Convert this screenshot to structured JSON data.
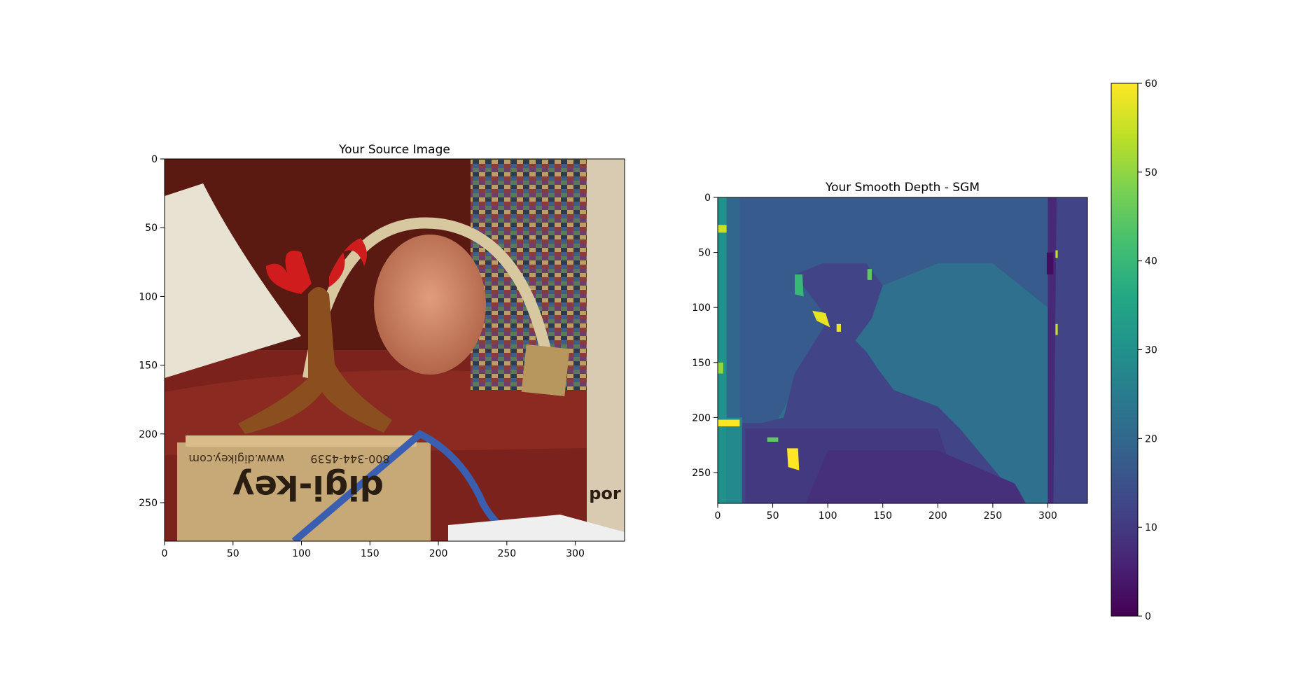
{
  "figure": {
    "panels": {
      "source": {
        "title": "Your Source Image"
      },
      "depth": {
        "title": "Your Smooth Depth - SGM"
      }
    }
  },
  "chart_data": [
    {
      "type": "image",
      "title": "Your Source Image",
      "xlim": [
        0,
        336
      ],
      "ylim": [
        278,
        0
      ],
      "x_ticks": [
        0,
        50,
        100,
        150,
        200,
        250,
        300
      ],
      "y_ticks": [
        0,
        50,
        100,
        150,
        200,
        250
      ],
      "content": {
        "box_text": [
          "www.digikey.com",
          "800-344-4539",
          "digi-key",
          "por"
        ]
      }
    },
    {
      "type": "heatmap",
      "title": "Your Smooth Depth - SGM",
      "colormap": "viridis",
      "xlim": [
        0,
        336
      ],
      "ylim": [
        278,
        0
      ],
      "x_ticks": [
        0,
        50,
        100,
        150,
        200,
        250,
        300
      ],
      "y_ticks": [
        0,
        50,
        100,
        150,
        200,
        250
      ],
      "colorbar": {
        "min": 0,
        "max": 60,
        "ticks": [
          0,
          10,
          20,
          30,
          40,
          50,
          60
        ]
      },
      "regions": [
        {
          "shape": "rect",
          "x": [
            0,
            336
          ],
          "y": [
            0,
            278
          ],
          "value": 20
        },
        {
          "shape": "path",
          "value": 22,
          "points": [
            [
              20,
              0
            ],
            [
              160,
              0
            ],
            [
              250,
              20
            ],
            [
              300,
              0
            ],
            [
              300,
              278
            ],
            [
              20,
              278
            ]
          ]
        },
        {
          "shape": "path",
          "value": 17,
          "points": [
            [
              30,
              0
            ],
            [
              300,
              0
            ],
            [
              300,
              100
            ],
            [
              250,
              60
            ],
            [
              200,
              60
            ],
            [
              150,
              80
            ],
            [
              100,
              120
            ],
            [
              50,
              210
            ],
            [
              30,
              278
            ],
            [
              20,
              278
            ],
            [
              20,
              0
            ]
          ]
        },
        {
          "shape": "path",
          "value": 12,
          "points": [
            [
              60,
              200
            ],
            [
              70,
              160
            ],
            [
              95,
              120
            ],
            [
              100,
              110
            ],
            [
              85,
              90
            ],
            [
              70,
              70
            ],
            [
              95,
              60
            ],
            [
              135,
              60
            ],
            [
              150,
              80
            ],
            [
              140,
              110
            ],
            [
              125,
              130
            ],
            [
              135,
              140
            ],
            [
              145,
              155
            ],
            [
              160,
              175
            ],
            [
              200,
              190
            ],
            [
              220,
              210
            ],
            [
              245,
              240
            ],
            [
              270,
              270
            ],
            [
              270,
              278
            ],
            [
              22,
              278
            ],
            [
              22,
              205
            ],
            [
              40,
              205
            ]
          ]
        },
        {
          "shape": "path",
          "value": 10,
          "points": [
            [
              25,
              210
            ],
            [
              200,
              210
            ],
            [
              210,
              240
            ],
            [
              200,
              278
            ],
            [
              25,
              278
            ]
          ]
        },
        {
          "shape": "path",
          "value": 8,
          "points": [
            [
              100,
              230
            ],
            [
              200,
              230
            ],
            [
              270,
              260
            ],
            [
              280,
              278
            ],
            [
              80,
              278
            ]
          ]
        },
        {
          "shape": "path",
          "value": 12,
          "points": [
            [
              302,
              0
            ],
            [
              336,
              0
            ],
            [
              336,
              278
            ],
            [
              302,
              278
            ]
          ]
        },
        {
          "shape": "path",
          "value": 7,
          "points": [
            [
              300,
              0
            ],
            [
              308,
              0
            ],
            [
              305,
              278
            ],
            [
              300,
              278
            ]
          ]
        },
        {
          "shape": "path",
          "value": 30,
          "points": [
            [
              0,
              0
            ],
            [
              8,
              0
            ],
            [
              8,
              278
            ],
            [
              0,
              278
            ]
          ]
        },
        {
          "shape": "path",
          "value": 28,
          "points": [
            [
              8,
              200
            ],
            [
              22,
              200
            ],
            [
              22,
              278
            ],
            [
              8,
              278
            ]
          ]
        },
        {
          "shape": "path",
          "value": 40,
          "points": [
            [
              70,
              70
            ],
            [
              77,
              70
            ],
            [
              78,
              90
            ],
            [
              70,
              88
            ]
          ]
        },
        {
          "shape": "path",
          "value": 58,
          "points": [
            [
              86,
              103
            ],
            [
              98,
              105
            ],
            [
              102,
              118
            ],
            [
              90,
              112
            ]
          ]
        },
        {
          "shape": "path",
          "value": 60,
          "points": [
            [
              63,
              228
            ],
            [
              73,
              228
            ],
            [
              74,
              248
            ],
            [
              64,
              245
            ]
          ]
        },
        {
          "shape": "path",
          "value": 60,
          "points": [
            [
              0,
              202
            ],
            [
              20,
              202
            ],
            [
              20,
              208
            ],
            [
              0,
              208
            ]
          ]
        },
        {
          "shape": "path",
          "value": 55,
          "points": [
            [
              0,
              25
            ],
            [
              8,
              25
            ],
            [
              8,
              32
            ],
            [
              0,
              32
            ]
          ]
        },
        {
          "shape": "path",
          "value": 50,
          "points": [
            [
              0,
              150
            ],
            [
              5,
              150
            ],
            [
              5,
              160
            ],
            [
              0,
              160
            ]
          ]
        },
        {
          "shape": "path",
          "value": 45,
          "points": [
            [
              45,
              218
            ],
            [
              55,
              218
            ],
            [
              55,
              222
            ],
            [
              45,
              222
            ]
          ]
        },
        {
          "shape": "path",
          "value": 58,
          "points": [
            [
              108,
              115
            ],
            [
              112,
              115
            ],
            [
              112,
              122
            ],
            [
              108,
              122
            ]
          ]
        },
        {
          "shape": "path",
          "value": 45,
          "points": [
            [
              136,
              65
            ],
            [
              140,
              65
            ],
            [
              140,
              75
            ],
            [
              136,
              75
            ]
          ]
        },
        {
          "shape": "path",
          "value": 2,
          "points": [
            [
              299,
              50
            ],
            [
              305,
              50
            ],
            [
              305,
              70
            ],
            [
              299,
              70
            ]
          ]
        },
        {
          "shape": "path",
          "value": 55,
          "points": [
            [
              307,
              48
            ],
            [
              309,
              48
            ],
            [
              309,
              55
            ],
            [
              307,
              55
            ]
          ]
        },
        {
          "shape": "path",
          "value": 55,
          "points": [
            [
              307,
              115
            ],
            [
              309,
              115
            ],
            [
              309,
              125
            ],
            [
              307,
              125
            ]
          ]
        }
      ]
    }
  ],
  "colors": {
    "viridis": [
      "#440154",
      "#482475",
      "#414487",
      "#355f8d",
      "#2a788e",
      "#21918c",
      "#22a884",
      "#44bf70",
      "#7ad151",
      "#bddf26",
      "#fde725"
    ]
  }
}
